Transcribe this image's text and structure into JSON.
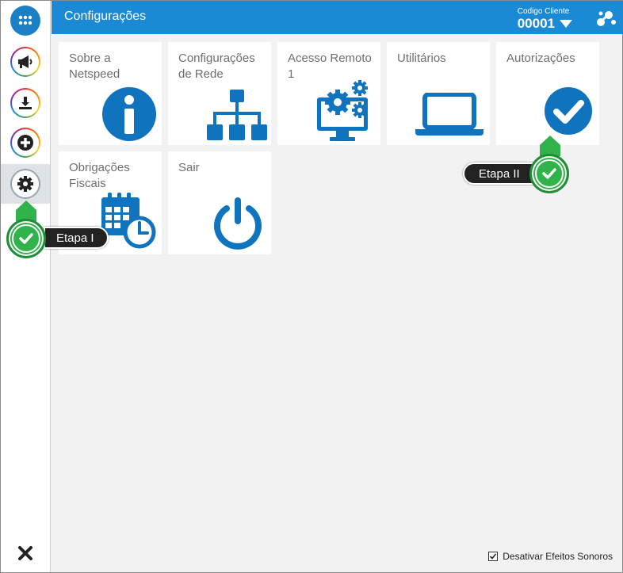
{
  "header": {
    "title": "Configurações",
    "client_label": "Codigo Cliente",
    "client_code": "00001"
  },
  "sidebar": {
    "items": [
      {
        "name": "apps",
        "icon": "grid-icon"
      },
      {
        "name": "announcements",
        "icon": "megaphone-icon"
      },
      {
        "name": "downloads",
        "icon": "download-icon"
      },
      {
        "name": "add",
        "icon": "plus-circle-icon"
      },
      {
        "name": "settings",
        "icon": "gear-icon",
        "active": true
      }
    ],
    "close_icon": "close-icon"
  },
  "tiles": [
    {
      "label": "Sobre a Netspeed",
      "icon": "info-icon"
    },
    {
      "label": "Configurações de Rede",
      "icon": "network-icon"
    },
    {
      "label": "Acesso Remoto 1",
      "icon": "remote-gears-icon"
    },
    {
      "label": "Utilitários",
      "icon": "laptop-icon"
    },
    {
      "label": "Autorizações",
      "icon": "check-circle-icon"
    },
    {
      "label": "Obrigações Fiscais",
      "icon": "calendar-clock-icon"
    },
    {
      "label": "Sair",
      "icon": "power-icon"
    }
  ],
  "callouts": {
    "step1": "Etapa I",
    "step2": "Etapa II"
  },
  "footer": {
    "sound_label": "Desativar Efeitos Sonoros",
    "sound_checked": true
  },
  "colors": {
    "accent": "#1b8ad6",
    "icon_blue": "#0f73be",
    "badge_green": "#2fb34a"
  }
}
